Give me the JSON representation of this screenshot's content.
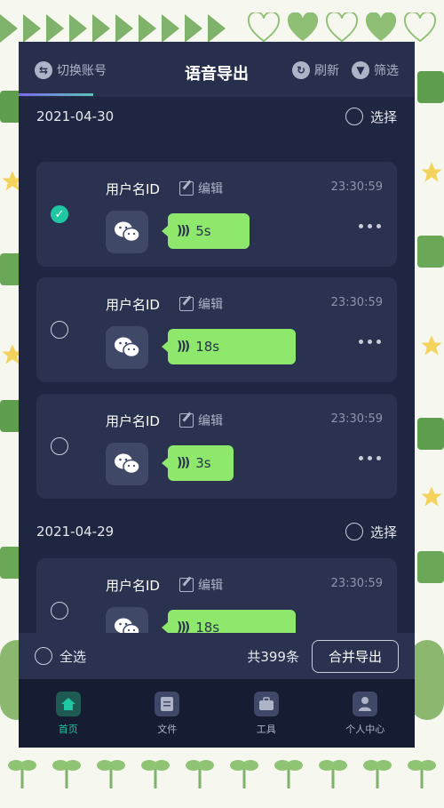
{
  "header": {
    "switch_account": "切换账号",
    "title": "语音导出",
    "refresh": "刷新",
    "filter": "筛选"
  },
  "groups": [
    {
      "date": "2021-04-30",
      "select_label": "选择",
      "items": [
        {
          "username": "用户名ID",
          "edit": "编辑",
          "time": "23:30:59",
          "duration": "5s",
          "checked": true
        },
        {
          "username": "用户名ID",
          "edit": "编辑",
          "time": "23:30:59",
          "duration": "18s",
          "checked": false
        },
        {
          "username": "用户名ID",
          "edit": "编辑",
          "time": "23:30:59",
          "duration": "3s",
          "checked": false
        }
      ]
    },
    {
      "date": "2021-04-29",
      "select_label": "选择",
      "items": [
        {
          "username": "用户名ID",
          "edit": "编辑",
          "time": "23:30:59",
          "duration": "18s",
          "checked": false
        }
      ]
    }
  ],
  "footer": {
    "select_all": "全选",
    "count": "共399条",
    "merge_export": "合并导出"
  },
  "nav": [
    {
      "label": "首页",
      "icon": "home-icon",
      "active": true
    },
    {
      "label": "文件",
      "icon": "file-icon",
      "active": false
    },
    {
      "label": "工具",
      "icon": "toolbox-icon",
      "active": false
    },
    {
      "label": "个人中心",
      "icon": "user-icon",
      "active": false
    }
  ],
  "colors": {
    "background": "#1f2641",
    "card": "#2a3250",
    "bubble": "#8ee86b",
    "accent": "#1fc8a2"
  }
}
